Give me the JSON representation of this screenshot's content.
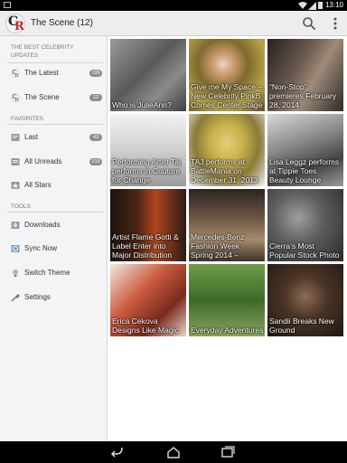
{
  "status": {
    "time": "13:10"
  },
  "app": {
    "title": "The Scene (12)"
  },
  "sidebar": {
    "sections": [
      {
        "heading": "THE BEST CELEBRITY UPDATES",
        "items": [
          {
            "label": "The Latest",
            "badge": "199",
            "icon": "logo-icon"
          },
          {
            "label": "The Scene",
            "badge": "12",
            "icon": "logo-icon"
          }
        ]
      },
      {
        "heading": "FAVORITES",
        "items": [
          {
            "label": "Last",
            "badge": "43",
            "icon": "clock-icon"
          },
          {
            "label": "All Unreads",
            "badge": "215",
            "icon": "unread-icon"
          },
          {
            "label": "All Stars",
            "badge": "",
            "icon": "star-icon"
          }
        ]
      },
      {
        "heading": "TOOLS",
        "items": [
          {
            "label": "Downloads",
            "badge": "",
            "icon": "download-icon"
          },
          {
            "label": "Sync Now",
            "badge": "",
            "icon": "sync-icon"
          },
          {
            "label": "Switch Theme",
            "badge": "",
            "icon": "bulb-icon"
          },
          {
            "label": "Settings",
            "badge": "",
            "icon": "wrench-icon"
          }
        ]
      }
    ]
  },
  "grid": {
    "items": [
      {
        "caption": "Who is JulieAnn?",
        "color": "#6e6e6e"
      },
      {
        "caption": "Give me My Space – New Celebrity PinkB Comes Center Stage",
        "color": "#b7a24a"
      },
      {
        "caption": "“Non-Stop” premieres February 28, 2014",
        "color": "#3e3a36"
      },
      {
        "caption": "Performing Artist Taj performs in Couture for Change",
        "color": "#cfcfcf"
      },
      {
        "caption": "TAJ performs at BattleMania on December 31, 2013",
        "color": "#b8a440"
      },
      {
        "caption": "Lisa Leggz performs at Tippie Toes Beauty Lounge",
        "color": "#7a7a7a"
      },
      {
        "caption": "Artist Flame Gotti & Label Enter into Major Distribution",
        "color": "#7a2a14"
      },
      {
        "caption": "Mercedes-Benz Fashion Week Spring 2014 –",
        "color": "#5a4c3e"
      },
      {
        "caption": "Cierra’s Most Popular Stock Photo",
        "color": "#6a6a6a"
      },
      {
        "caption": "Erica Cekova Designs Like Magic",
        "color": "#9a4a34"
      },
      {
        "caption": "Everyday Adventures",
        "color": "#4e7a36"
      },
      {
        "caption": "Sandii Breaks New Ground",
        "color": "#352a22"
      }
    ]
  }
}
